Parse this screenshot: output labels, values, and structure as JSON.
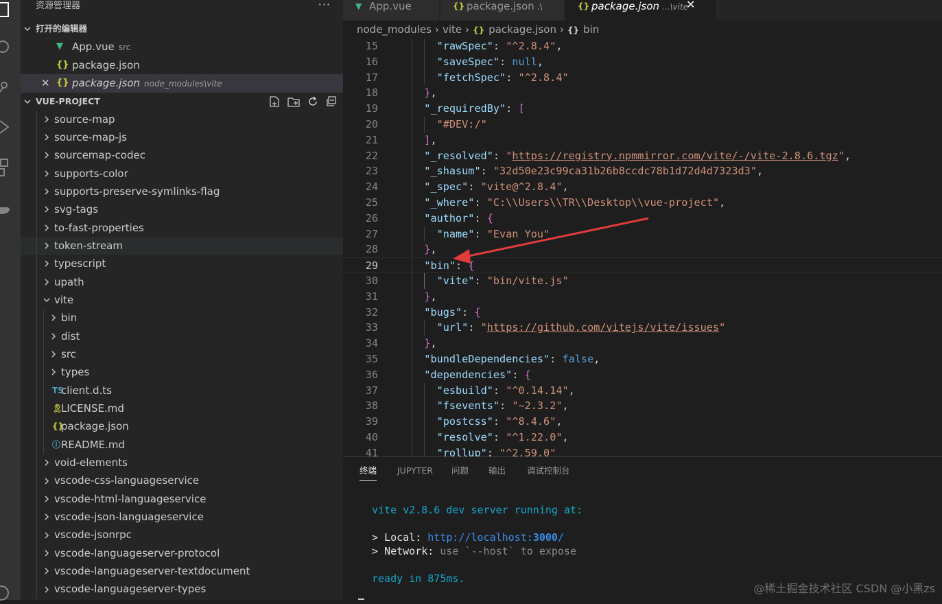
{
  "sidebar": {
    "title": "资源管理器",
    "more": "···",
    "open_editors": {
      "title": "打开的编辑器",
      "items": [
        {
          "icon": "V",
          "label": "App.vue",
          "desc": "src",
          "active": false,
          "italic": false
        },
        {
          "icon": "{}",
          "label": "package.json",
          "desc": "",
          "active": false,
          "italic": false
        },
        {
          "icon": "{}",
          "label": "package.json",
          "desc": "node_modules\\vite",
          "active": true,
          "italic": true
        }
      ]
    },
    "project": {
      "title": "VUE-PROJECT",
      "tree": [
        {
          "label": "source-map",
          "depth": 0,
          "type": "folder"
        },
        {
          "label": "source-map-js",
          "depth": 0,
          "type": "folder"
        },
        {
          "label": "sourcemap-codec",
          "depth": 0,
          "type": "folder"
        },
        {
          "label": "supports-color",
          "depth": 0,
          "type": "folder"
        },
        {
          "label": "supports-preserve-symlinks-flag",
          "depth": 0,
          "type": "folder"
        },
        {
          "label": "svg-tags",
          "depth": 0,
          "type": "folder"
        },
        {
          "label": "to-fast-properties",
          "depth": 0,
          "type": "folder"
        },
        {
          "label": "token-stream",
          "depth": 0,
          "type": "folder",
          "hover": true
        },
        {
          "label": "typescript",
          "depth": 0,
          "type": "folder"
        },
        {
          "label": "upath",
          "depth": 0,
          "type": "folder"
        },
        {
          "label": "vite",
          "depth": 0,
          "type": "folder-open"
        },
        {
          "label": "bin",
          "depth": 1,
          "type": "folder"
        },
        {
          "label": "dist",
          "depth": 1,
          "type": "folder"
        },
        {
          "label": "src",
          "depth": 1,
          "type": "folder"
        },
        {
          "label": "types",
          "depth": 1,
          "type": "folder"
        },
        {
          "label": "client.d.ts",
          "depth": 1,
          "type": "file",
          "icon": "TS",
          "color": "#519aba"
        },
        {
          "label": "LICENSE.md",
          "depth": 1,
          "type": "file",
          "icon": "🎗",
          "color": "#cbcb41"
        },
        {
          "label": "package.json",
          "depth": 1,
          "type": "file",
          "icon": "{}",
          "color": "#cbcb41"
        },
        {
          "label": "README.md",
          "depth": 1,
          "type": "file",
          "icon": "ⓘ",
          "color": "#519aba"
        },
        {
          "label": "void-elements",
          "depth": 0,
          "type": "folder"
        },
        {
          "label": "vscode-css-languageservice",
          "depth": 0,
          "type": "folder"
        },
        {
          "label": "vscode-html-languageservice",
          "depth": 0,
          "type": "folder"
        },
        {
          "label": "vscode-json-languageservice",
          "depth": 0,
          "type": "folder"
        },
        {
          "label": "vscode-jsonrpc",
          "depth": 0,
          "type": "folder"
        },
        {
          "label": "vscode-languageserver-protocol",
          "depth": 0,
          "type": "folder"
        },
        {
          "label": "vscode-languageserver-textdocument",
          "depth": 0,
          "type": "folder"
        },
        {
          "label": "vscode-languageserver-types",
          "depth": 0,
          "type": "folder"
        }
      ]
    }
  },
  "tabs": [
    {
      "icon": "V",
      "label": "App.vue",
      "desc": "",
      "active": false,
      "italic": false
    },
    {
      "icon": "{}",
      "label": "package.json",
      "desc": ".\\",
      "active": false,
      "italic": false
    },
    {
      "icon": "{}",
      "label": "package.json",
      "desc": "...\\vite",
      "active": true,
      "italic": true
    }
  ],
  "breadcrumb": {
    "items": [
      "node_modules",
      "vite",
      "package.json",
      "bin"
    ],
    "icons": [
      "",
      "",
      "{}",
      "{}"
    ]
  },
  "editor": {
    "current_line": 29,
    "lines": [
      {
        "n": 15,
        "indent": 2,
        "tokens": [
          [
            "k",
            "\"rawSpec\""
          ],
          [
            "p",
            ": "
          ],
          [
            "s",
            "\"^2.8.4\""
          ],
          [
            "p",
            ","
          ]
        ]
      },
      {
        "n": 16,
        "indent": 2,
        "tokens": [
          [
            "k",
            "\"saveSpec\""
          ],
          [
            "p",
            ": "
          ],
          [
            "b",
            "null"
          ],
          [
            "p",
            ","
          ]
        ]
      },
      {
        "n": 17,
        "indent": 2,
        "tokens": [
          [
            "k",
            "\"fetchSpec\""
          ],
          [
            "p",
            ": "
          ],
          [
            "s",
            "\"^2.8.4\""
          ]
        ]
      },
      {
        "n": 18,
        "indent": 1,
        "tokens": [
          [
            "br1",
            "}"
          ],
          [
            "p",
            ","
          ]
        ]
      },
      {
        "n": 19,
        "indent": 1,
        "tokens": [
          [
            "k",
            "\"_requiredBy\""
          ],
          [
            "p",
            ": "
          ],
          [
            "br1",
            "["
          ]
        ]
      },
      {
        "n": 20,
        "indent": 2,
        "tokens": [
          [
            "s",
            "\"#DEV:/\""
          ]
        ]
      },
      {
        "n": 21,
        "indent": 1,
        "tokens": [
          [
            "br1",
            "]"
          ],
          [
            "p",
            ","
          ]
        ]
      },
      {
        "n": 22,
        "indent": 1,
        "tokens": [
          [
            "k",
            "\"_resolved\""
          ],
          [
            "p",
            ": "
          ],
          [
            "s",
            "\""
          ],
          [
            "lnk",
            "https://registry.npmmirror.com/vite/-/vite-2.8.6.tgz"
          ],
          [
            "s",
            "\""
          ],
          [
            "p",
            ","
          ]
        ]
      },
      {
        "n": 23,
        "indent": 1,
        "tokens": [
          [
            "k",
            "\"_shasum\""
          ],
          [
            "p",
            ": "
          ],
          [
            "s",
            "\"32d50e23c99ca31b26b8ccdc78b1d72d4d7323d3\""
          ],
          [
            "p",
            ","
          ]
        ]
      },
      {
        "n": 24,
        "indent": 1,
        "tokens": [
          [
            "k",
            "\"_spec\""
          ],
          [
            "p",
            ": "
          ],
          [
            "s",
            "\"vite@^2.8.4\""
          ],
          [
            "p",
            ","
          ]
        ]
      },
      {
        "n": 25,
        "indent": 1,
        "tokens": [
          [
            "k",
            "\"_where\""
          ],
          [
            "p",
            ": "
          ],
          [
            "s",
            "\"C:\\\\Users\\\\TR\\\\Desktop\\\\vue-project\""
          ],
          [
            "p",
            ","
          ]
        ]
      },
      {
        "n": 26,
        "indent": 1,
        "tokens": [
          [
            "k",
            "\"author\""
          ],
          [
            "p",
            ": "
          ],
          [
            "br1",
            "{"
          ]
        ]
      },
      {
        "n": 27,
        "indent": 2,
        "tokens": [
          [
            "k",
            "\"name\""
          ],
          [
            "p",
            ": "
          ],
          [
            "s",
            "\"Evan You\""
          ]
        ]
      },
      {
        "n": 28,
        "indent": 1,
        "tokens": [
          [
            "br1",
            "}"
          ],
          [
            "p",
            ","
          ]
        ]
      },
      {
        "n": 29,
        "indent": 1,
        "tokens": [
          [
            "k",
            "\"bin\""
          ],
          [
            "p",
            ": "
          ],
          [
            "br1",
            "{"
          ]
        ]
      },
      {
        "n": 30,
        "indent": 2,
        "tokens": [
          [
            "k",
            "\"vite\""
          ],
          [
            "p",
            ": "
          ],
          [
            "s",
            "\"bin/vite.js\""
          ]
        ]
      },
      {
        "n": 31,
        "indent": 1,
        "tokens": [
          [
            "br1",
            "}"
          ],
          [
            "p",
            ","
          ]
        ]
      },
      {
        "n": 32,
        "indent": 1,
        "tokens": [
          [
            "k",
            "\"bugs\""
          ],
          [
            "p",
            ": "
          ],
          [
            "br1",
            "{"
          ]
        ]
      },
      {
        "n": 33,
        "indent": 2,
        "tokens": [
          [
            "k",
            "\"url\""
          ],
          [
            "p",
            ": "
          ],
          [
            "s",
            "\""
          ],
          [
            "lnk",
            "https://github.com/vitejs/vite/issues"
          ],
          [
            "s",
            "\""
          ]
        ]
      },
      {
        "n": 34,
        "indent": 1,
        "tokens": [
          [
            "br1",
            "}"
          ],
          [
            "p",
            ","
          ]
        ]
      },
      {
        "n": 35,
        "indent": 1,
        "tokens": [
          [
            "k",
            "\"bundleDependencies\""
          ],
          [
            "p",
            ": "
          ],
          [
            "b",
            "false"
          ],
          [
            "p",
            ","
          ]
        ]
      },
      {
        "n": 36,
        "indent": 1,
        "tokens": [
          [
            "k",
            "\"dependencies\""
          ],
          [
            "p",
            ": "
          ],
          [
            "br1",
            "{"
          ]
        ]
      },
      {
        "n": 37,
        "indent": 2,
        "tokens": [
          [
            "k",
            "\"esbuild\""
          ],
          [
            "p",
            ": "
          ],
          [
            "s",
            "\"^0.14.14\""
          ],
          [
            "p",
            ","
          ]
        ]
      },
      {
        "n": 38,
        "indent": 2,
        "tokens": [
          [
            "k",
            "\"fsevents\""
          ],
          [
            "p",
            ": "
          ],
          [
            "s",
            "\"~2.3.2\""
          ],
          [
            "p",
            ","
          ]
        ]
      },
      {
        "n": 39,
        "indent": 2,
        "tokens": [
          [
            "k",
            "\"postcss\""
          ],
          [
            "p",
            ": "
          ],
          [
            "s",
            "\"^8.4.6\""
          ],
          [
            "p",
            ","
          ]
        ]
      },
      {
        "n": 40,
        "indent": 2,
        "tokens": [
          [
            "k",
            "\"resolve\""
          ],
          [
            "p",
            ": "
          ],
          [
            "s",
            "\"^1.22.0\""
          ],
          [
            "p",
            ","
          ]
        ]
      },
      {
        "n": 41,
        "indent": 2,
        "tokens": [
          [
            "k",
            "\"rollup\""
          ],
          [
            "p",
            ": "
          ],
          [
            "s",
            "\"^2.59.0\""
          ]
        ]
      }
    ]
  },
  "panel": {
    "tabs": [
      "终端",
      "JUPYTER",
      "问题",
      "输出",
      "调试控制台"
    ],
    "active_tab": "终端",
    "terminal": {
      "line1": "vite v2.8.6 dev server running at:",
      "local_prefix": "> ",
      "local_label": "Local:",
      "local_url_start": "http://localhost:",
      "local_port": "3000",
      "local_url_end": "/",
      "network_prefix": "> ",
      "network_label": "Network:",
      "network_hint": "use `--host` to expose",
      "ready": "ready in 875ms."
    }
  },
  "watermark": "@稀土掘金技术社区 CSDN @小黑zs",
  "colors": {
    "accent_annotation": "#e03c3c",
    "vue_green": "#41b883",
    "json_yellow": "#cbcb41"
  }
}
